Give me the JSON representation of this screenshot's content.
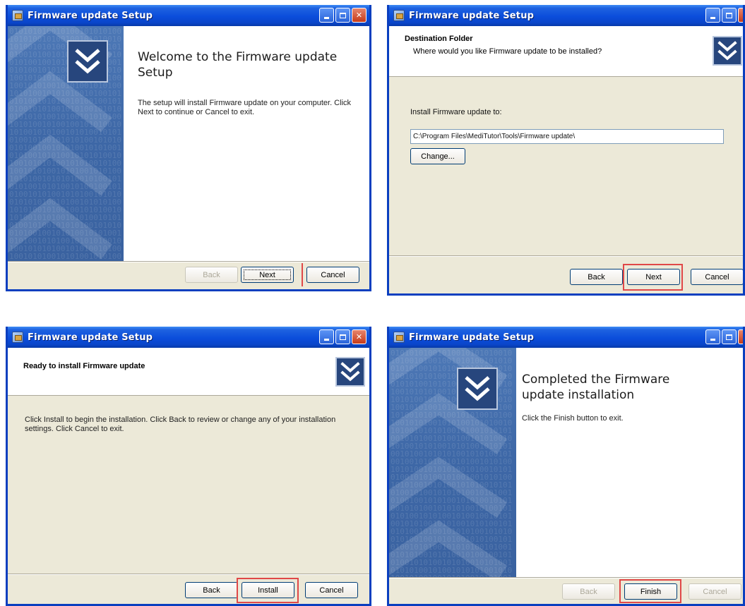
{
  "window_title": "Firmware update Setup",
  "panel1": {
    "heading": "Welcome to the Firmware update Setup",
    "body": "The setup will install Firmware update on your computer. Click Next to continue or Cancel to exit.",
    "back": "Back",
    "next": "Next",
    "cancel": "Cancel"
  },
  "panel2": {
    "section_title": "Destination Folder",
    "section_sub": "Where would you like Firmware update to be installed?",
    "install_label": "Install Firmware update to:",
    "path_value": "C:\\Program Files\\MediTutor\\Tools\\Firmware update\\",
    "change": "Change...",
    "back": "Back",
    "next": "Next",
    "cancel": "Cancel"
  },
  "panel3": {
    "section_title": "Ready to install Firmware update",
    "body": "Click Install to begin the installation. Click Back to review or change any of your installation settings. Click Cancel to exit.",
    "back": "Back",
    "install": "Install",
    "cancel": "Cancel"
  },
  "panel4": {
    "heading": "Completed the Firmware update installation",
    "body": "Click the Finish button to exit.",
    "back": "Back",
    "finish": "Finish",
    "cancel": "Cancel"
  },
  "colors": {
    "titlebar": "#0b4ddb",
    "dialog_bg": "#ece9d8",
    "banner": "#3d67a6",
    "highlight": "#e04848"
  }
}
